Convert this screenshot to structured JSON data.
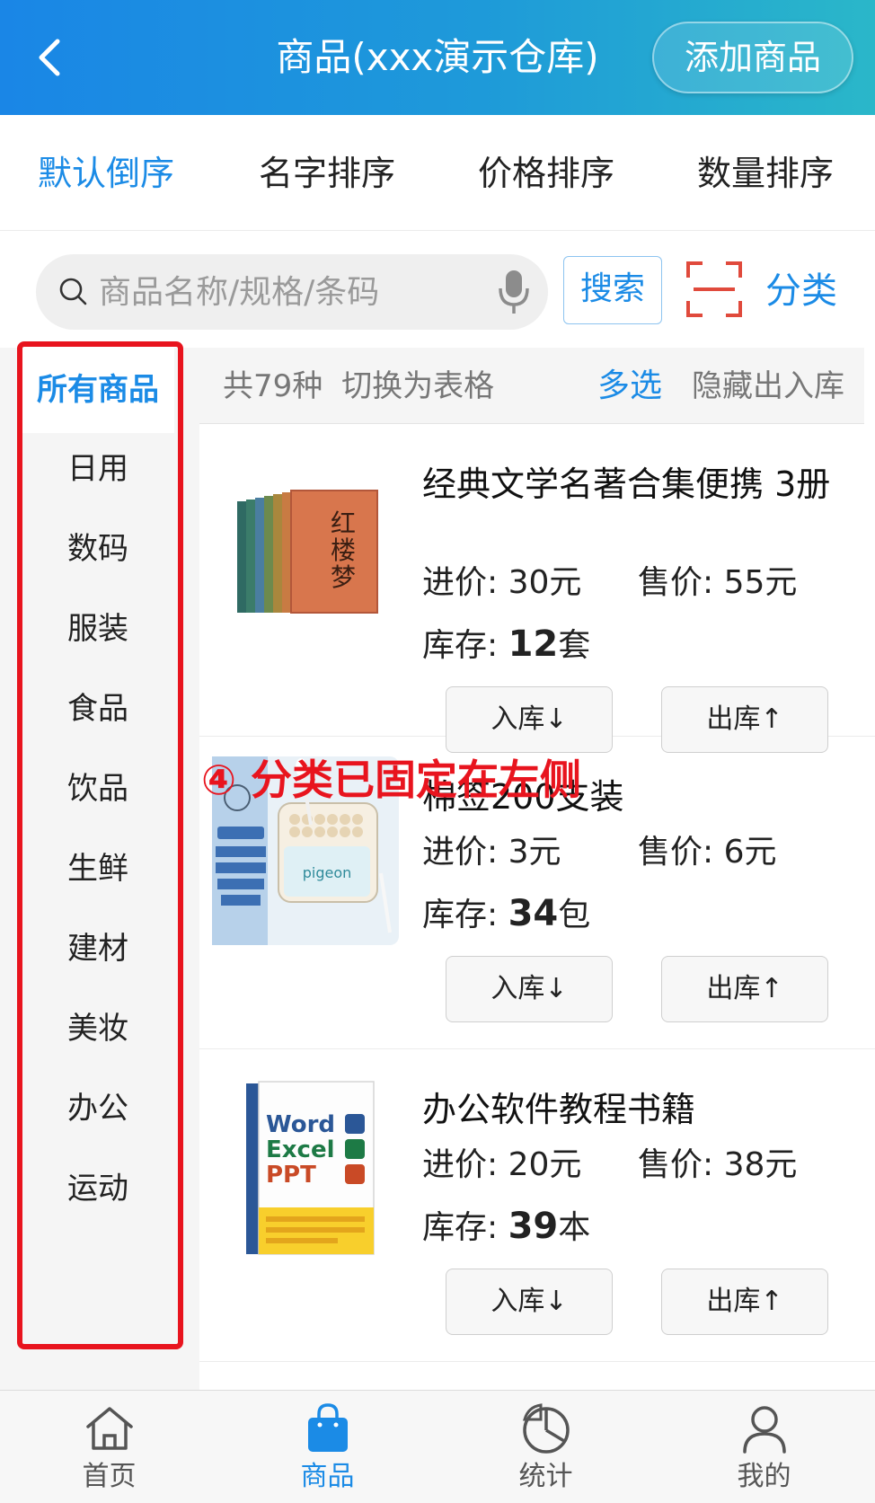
{
  "header": {
    "title": "商品(xxx演示仓库)",
    "add_button": "添加商品"
  },
  "sort_tabs": [
    {
      "label": "默认倒序",
      "active": true
    },
    {
      "label": "名字排序",
      "active": false
    },
    {
      "label": "价格排序",
      "active": false
    },
    {
      "label": "数量排序",
      "active": false
    }
  ],
  "search": {
    "placeholder": "商品名称/规格/条码",
    "value": "",
    "button": "搜索",
    "category": "分类"
  },
  "sidebar": {
    "items": [
      {
        "label": "所有商品",
        "active": true
      },
      {
        "label": "日用",
        "active": false
      },
      {
        "label": "数码",
        "active": false
      },
      {
        "label": "服装",
        "active": false
      },
      {
        "label": "食品",
        "active": false
      },
      {
        "label": "饮品",
        "active": false
      },
      {
        "label": "生鲜",
        "active": false
      },
      {
        "label": "建材",
        "active": false
      },
      {
        "label": "美妆",
        "active": false
      },
      {
        "label": "办公",
        "active": false
      },
      {
        "label": "运动",
        "active": false
      }
    ]
  },
  "info_bar": {
    "count_text": "共79种",
    "switch_text": "切换为表格",
    "multi_select": "多选",
    "hide_inout": "隐藏出入库"
  },
  "annotation": "④ 分类已固定在左侧",
  "products": [
    {
      "name": "经典文学名著合集便携 3册",
      "cost_label": "进价:",
      "cost": "30元",
      "sale_label": "售价:",
      "sale": "55元",
      "stock_label": "库存:",
      "stock": "12",
      "unit": "套",
      "in_button": "入库↓",
      "out_button": "出库↑",
      "image": "book-set-image"
    },
    {
      "name": "棉签200支装",
      "cost_label": "进价:",
      "cost": "3元",
      "sale_label": "售价:",
      "sale": "6元",
      "stock_label": "库存:",
      "stock": "34",
      "unit": "包",
      "in_button": "入库↓",
      "out_button": "出库↑",
      "image": "cotton-swab-image"
    },
    {
      "name": "办公软件教程书籍",
      "cost_label": "进价:",
      "cost": "20元",
      "sale_label": "售价:",
      "sale": "38元",
      "stock_label": "库存:",
      "stock": "39",
      "unit": "本",
      "in_button": "入库↓",
      "out_button": "出库↑",
      "image": "office-book-image"
    }
  ],
  "tabbar": [
    {
      "label": "首页",
      "icon": "home-icon",
      "active": false
    },
    {
      "label": "商品",
      "icon": "shopping-bag-icon",
      "active": true
    },
    {
      "label": "统计",
      "icon": "pie-chart-icon",
      "active": false
    },
    {
      "label": "我的",
      "icon": "user-icon",
      "active": false
    }
  ],
  "colors": {
    "accent": "#1b8be6",
    "annotation_red": "#e8141e",
    "header_gradient_start": "#1a86e6",
    "header_gradient_end": "#2ab7c9"
  }
}
